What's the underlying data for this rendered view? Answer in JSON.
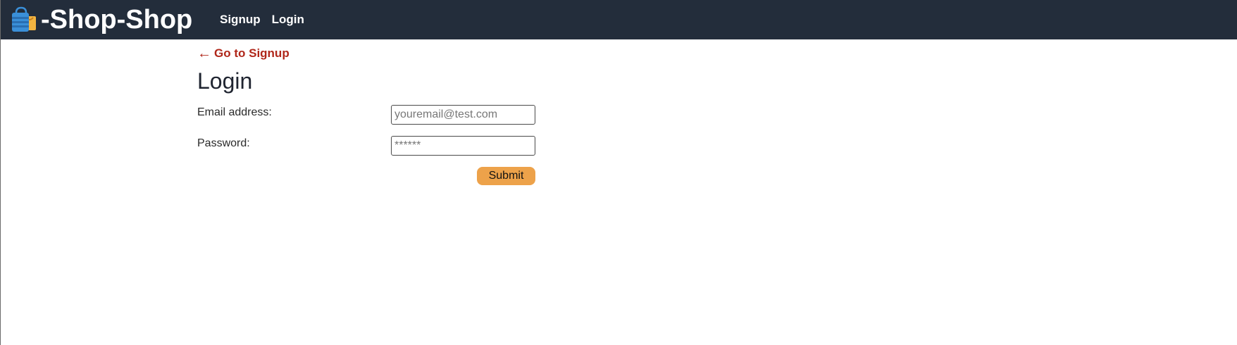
{
  "header": {
    "brand": "-Shop-Shop",
    "brand_icon": "shopping-bags-icon",
    "nav": [
      {
        "label": "Signup"
      },
      {
        "label": "Login"
      }
    ]
  },
  "main": {
    "back_link_arrow": "←",
    "back_link_label": "Go to Signup",
    "title": "Login",
    "email": {
      "label": "Email address:",
      "placeholder": "youremail@test.com",
      "value": ""
    },
    "password": {
      "label": "Password:",
      "placeholder": "******",
      "value": ""
    },
    "submit_label": "Submit"
  },
  "colors": {
    "navbar": "#232d3b",
    "back_link": "#b0271a",
    "submit_button": "#eda24a"
  }
}
